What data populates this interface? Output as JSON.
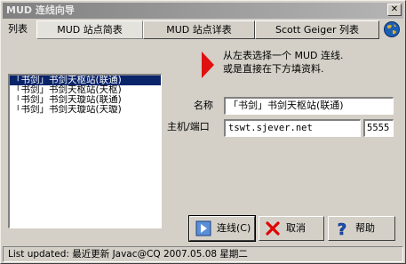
{
  "window": {
    "title": "MUD 连线向导",
    "close_label": "✕"
  },
  "tabs": {
    "list_label": "列表",
    "items": [
      {
        "label": "MUD 站点简表"
      },
      {
        "label": "MUD 站点详表"
      },
      {
        "label": "Scott Geiger 列表"
      }
    ]
  },
  "servers": [
    {
      "label": "「书剑」书剑天枢站(联通)",
      "selected": true
    },
    {
      "label": "「书剑」书剑天枢站(天枢)",
      "selected": false
    },
    {
      "label": "「书剑」书剑天璇站(联通)",
      "selected": false
    },
    {
      "label": "「书剑」书剑天璇站(天璇)",
      "selected": false
    }
  ],
  "hint": {
    "line1": "从左表选择一个 MUD 连线.",
    "line2": "或是直接在下方填资料."
  },
  "form": {
    "name_label": "名称",
    "name_value": "「书剑」书剑天枢站(联通)",
    "host_label": "主机/端口",
    "host_value": "tswt.sjever.net",
    "port_value": "5555"
  },
  "buttons": {
    "connect": "连线(C)",
    "cancel": "取消",
    "help": "帮助"
  },
  "status": {
    "text": "List updated: 最近更新 Javac@CQ  2007.05.08 星期二"
  },
  "colors": {
    "arrow": "#e01010",
    "selection": "#0a246a",
    "face": "#d4d0c8"
  }
}
